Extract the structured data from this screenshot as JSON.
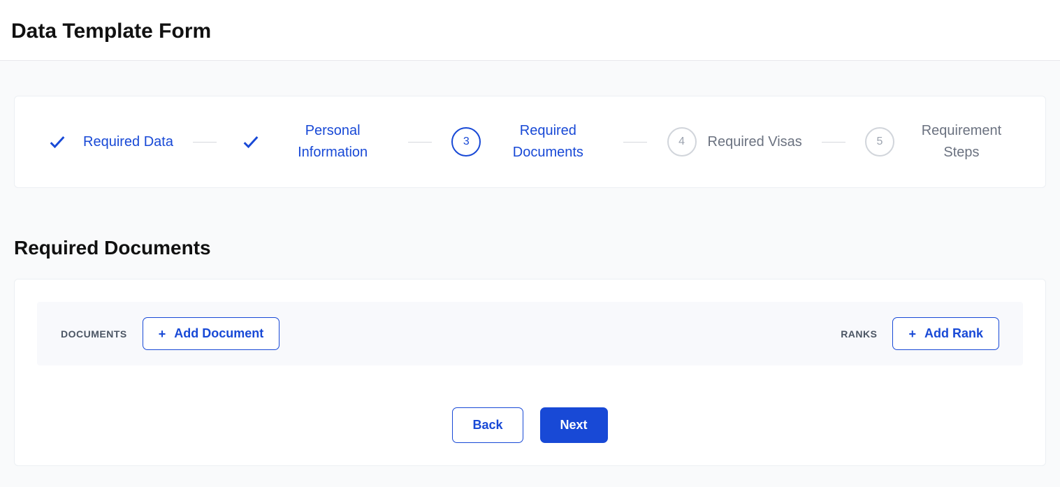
{
  "page": {
    "title": "Data Template Form"
  },
  "stepper": {
    "steps": [
      {
        "label": "Required Data",
        "state": "done"
      },
      {
        "label": "Personal Information",
        "state": "done"
      },
      {
        "label": "Required Documents",
        "state": "current",
        "number": "3"
      },
      {
        "label": "Required Visas",
        "state": "pending",
        "number": "4"
      },
      {
        "label": "Requirement Steps",
        "state": "pending",
        "number": "5"
      }
    ]
  },
  "section": {
    "title": "Required Documents"
  },
  "toolbar": {
    "documents_label": "DOCUMENTS",
    "add_document_label": "Add Document",
    "ranks_label": "RANKS",
    "add_rank_label": "Add Rank"
  },
  "footer": {
    "back_label": "Back",
    "next_label": "Next"
  }
}
